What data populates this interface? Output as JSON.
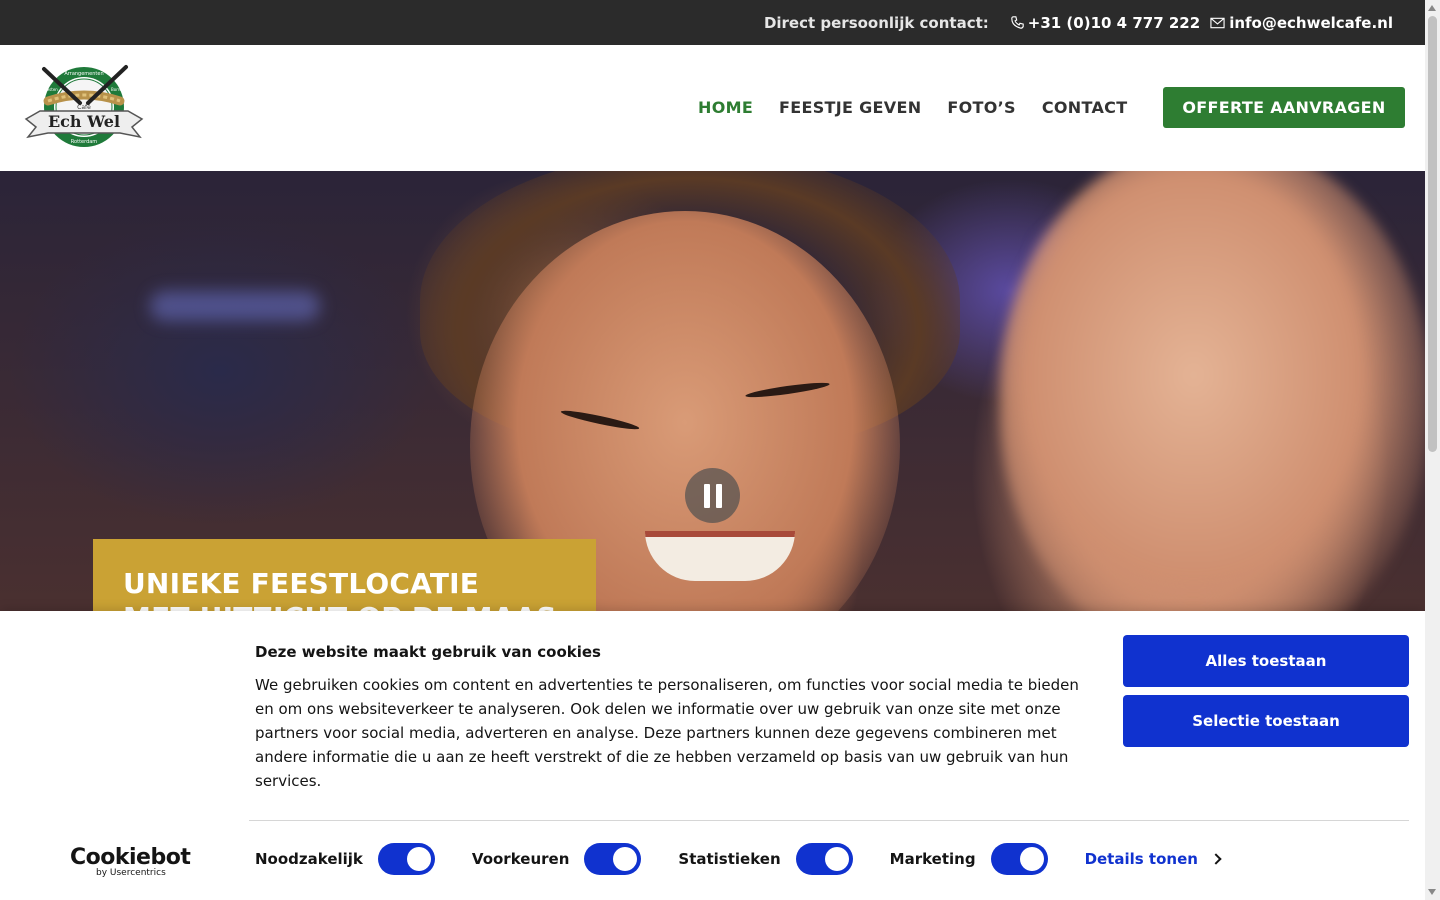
{
  "topbar": {
    "contact_label": "Direct persoonlijk contact:",
    "phone": "+31 (0)10 4 777 222",
    "email": "info@echwelcafe.nl",
    "phone_icon": "phone-icon",
    "email_icon": "mail-icon"
  },
  "logo": {
    "text_main": "Ech Wel",
    "text_small": "Café",
    "text_ring_left": "Feesten",
    "text_ring_top": "Arrangementen",
    "text_ring_right": "Borrels",
    "text_ring_bottom": "Rotterdam"
  },
  "nav": {
    "items": [
      {
        "label": "HOME",
        "active": true
      },
      {
        "label": "FEESTJE GEVEN",
        "active": false
      },
      {
        "label": "FOTO’S",
        "active": false
      },
      {
        "label": "CONTACT",
        "active": false
      }
    ],
    "cta_label": "OFFERTE AANVRAGEN"
  },
  "hero": {
    "heading": "UNIEKE FEESTLOCATIE\nMET UITZICHT OP DE MAAS",
    "pause_icon": "pause-icon"
  },
  "cookie": {
    "title": "Deze website maakt gebruik van cookies",
    "body": "We gebruiken cookies om content en advertenties te personaliseren, om functies voor social media te bieden en om ons websiteverkeer te analyseren. Ook delen we informatie over uw gebruik van onze site met onze partners voor social media, adverteren en analyse. Deze partners kunnen deze gegevens combineren met andere informatie die u aan ze heeft verstrekt of die ze hebben verzameld op basis van uw gebruik van hun services.",
    "allow_all": "Alles toestaan",
    "allow_selection": "Selectie toestaan",
    "brand": "Cookiebot",
    "brand_sub": "by Usercentrics",
    "toggles": [
      {
        "label": "Noodzakelijk",
        "on": true
      },
      {
        "label": "Voorkeuren",
        "on": true
      },
      {
        "label": "Statistieken",
        "on": true
      },
      {
        "label": "Marketing",
        "on": true
      }
    ],
    "details_label": "Details tonen",
    "accent": "#1032cf"
  },
  "colors": {
    "topbar_bg": "#2b2b2b",
    "brand_green": "#2e7d32",
    "hero_box": "#caa234"
  }
}
